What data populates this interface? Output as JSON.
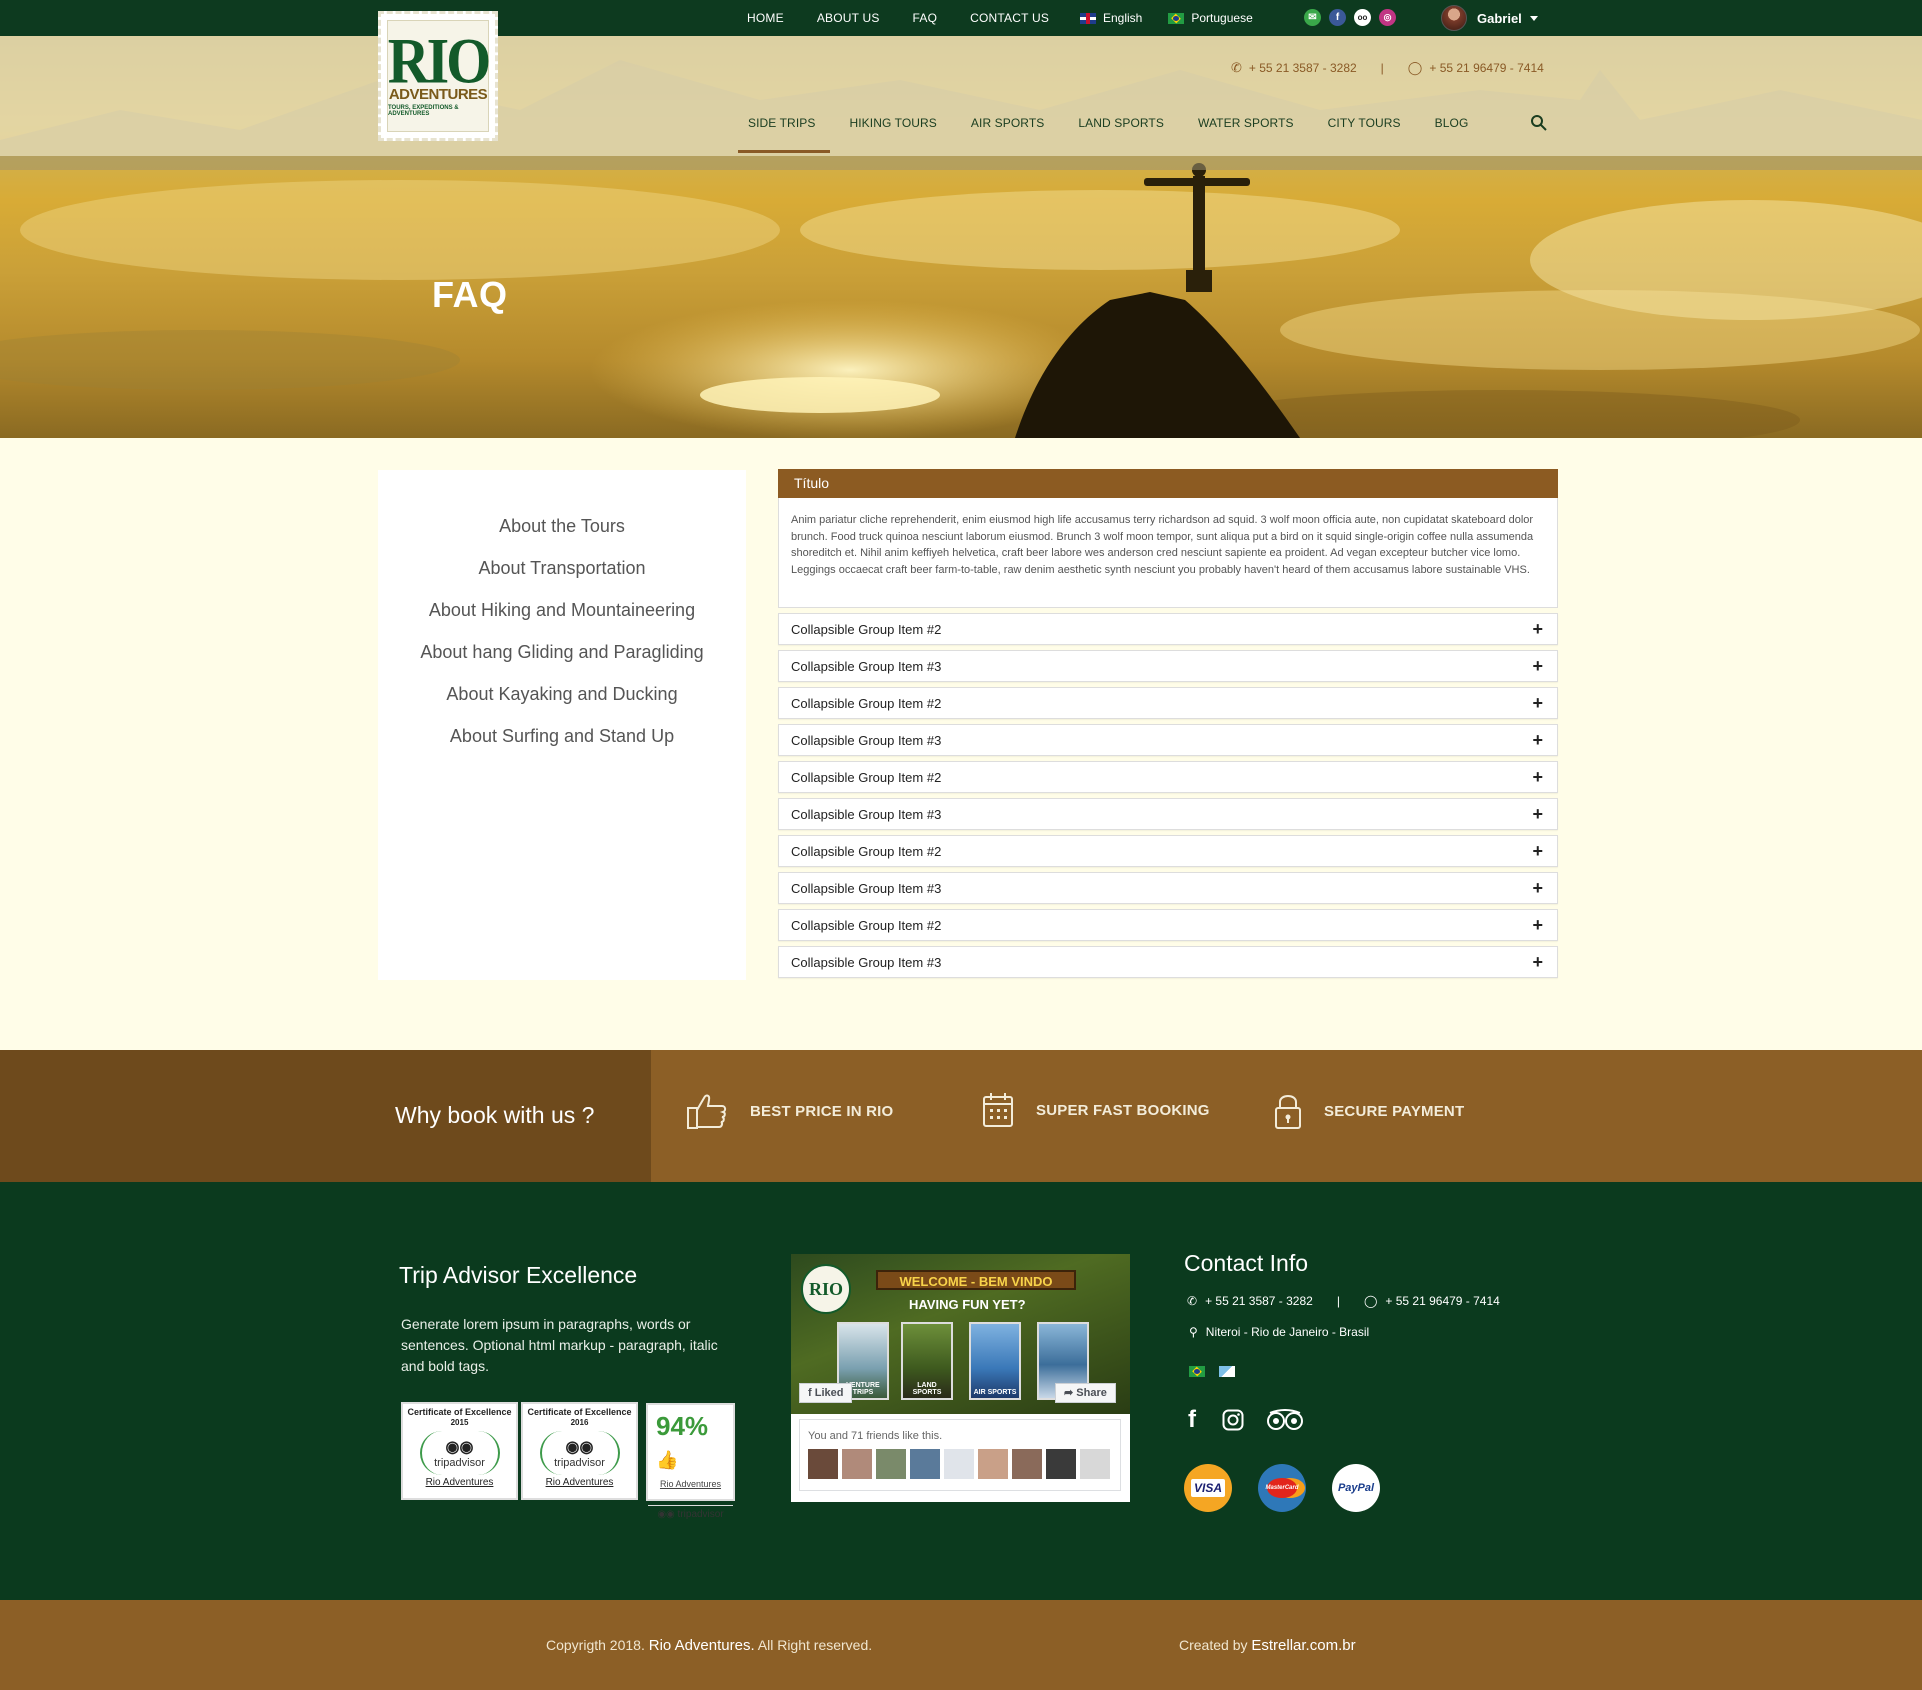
{
  "topbar": {
    "nav": [
      "HOME",
      "ABOUT US",
      "FAQ",
      "CONTACT US"
    ],
    "languages": [
      {
        "label": "English",
        "flag": "uk-flag-icon"
      },
      {
        "label": "Portuguese",
        "flag": "brazil-flag-icon"
      }
    ],
    "socials": [
      {
        "name": "email-icon",
        "color": "#3aa84a"
      },
      {
        "name": "facebook-icon",
        "color": "#3b5998"
      },
      {
        "name": "tripadvisor-icon",
        "color": "#555555"
      },
      {
        "name": "instagram-icon",
        "color": "#c13584"
      }
    ],
    "user": "Gabriel"
  },
  "header": {
    "logo_main": "RIO",
    "logo_sub": "ADVENTURES",
    "logo_tagline": "TOURS, EXPEDITIONS & ADVENTURES",
    "phone": "+ 55 21 3587 - 3282",
    "whatsapp": "+ 55 21 96479 - 7414",
    "separator": "|",
    "nav": [
      "SIDE TRIPS",
      "HIKING TOURS",
      "AIR SPORTS",
      "LAND SPORTS",
      "WATER SPORTS",
      "CITY TOURS",
      "BLOG"
    ],
    "active_nav": "SIDE TRIPS"
  },
  "hero": {
    "title": "FAQ"
  },
  "sidebar": {
    "items": [
      "About the Tours",
      "About Transportation",
      "About Hiking and Mountaineering",
      "About hang Gliding and Paragliding",
      "About Kayaking and Ducking",
      "About Surfing and Stand Up"
    ]
  },
  "faq": {
    "open_title": "Título",
    "open_body": "Anim pariatur cliche reprehenderit, enim eiusmod high life accusamus terry richardson ad squid. 3 wolf moon officia aute, non cupidatat skateboard dolor brunch. Food truck quinoa nesciunt laborum eiusmod. Brunch 3 wolf moon tempor, sunt aliqua put a bird on it squid single-origin coffee nulla assumenda shoreditch et. Nihil anim keffiyeh helvetica, craft beer labore wes anderson cred nesciunt sapiente ea proident. Ad vegan excepteur butcher vice lomo. Leggings occaecat craft beer farm-to-table, raw denim aesthetic synth nesciunt you probably haven't heard of them accusamus labore sustainable VHS.",
    "items": [
      "Collapsible Group Item #2",
      "Collapsible Group Item #3",
      "Collapsible Group Item #2",
      "Collapsible Group Item #3",
      "Collapsible Group Item #2",
      "Collapsible Group Item #3",
      "Collapsible Group Item #2",
      "Collapsible Group Item #3",
      "Collapsible Group Item #2",
      "Collapsible Group Item #3"
    ],
    "plus": "+"
  },
  "why": {
    "title": "Why book with us ?",
    "items": [
      "BEST PRICE IN RIO",
      "SUPER FAST BOOKING",
      "SECURE PAYMENT"
    ]
  },
  "footer": {
    "tripadvisor_title": "Trip Advisor Excellence",
    "tripadvisor_text": "Generate lorem ipsum in paragraphs, words or sentences. Optional html markup - paragraph, italic and bold tags.",
    "certs": [
      {
        "title": "Certificate of Excellence",
        "year": "2015",
        "brand": "tripadvisor",
        "link": "Rio Adventures"
      },
      {
        "title": "Certificate of Excellence",
        "year": "2016",
        "brand": "tripadvisor",
        "link": "Rio Adventures"
      }
    ],
    "score": {
      "value": "94%",
      "link": "Rio Adventures",
      "brand": "tripadvisor"
    },
    "fb": {
      "welcome": "WELCOME - BEM VINDO",
      "fun": "HAVING FUN YET?",
      "liked": "Liked",
      "share": "Share",
      "likes_text": "You and 71 friends like this.",
      "pic_labels": [
        "VENTURE TRIPS",
        "LAND SPORTS",
        "AIR SPORTS",
        ""
      ]
    },
    "contact_title": "Contact Info",
    "phone": "+ 55 21 3587 - 3282",
    "whatsapp": "+ 55 21 96479 - 7414",
    "separator": "|",
    "address": "Niteroi - Rio de Janeiro - Brasil",
    "payments": [
      "VISA",
      "MasterCard",
      "PayPal"
    ]
  },
  "copyright": {
    "left_pre": "Copyrigth 2018.",
    "left_brand": "Rio Adventures.",
    "left_post": "All Right reserved.",
    "right_pre": "Created by",
    "right_brand": "Estrellar.com.br"
  },
  "colors": {
    "dark_green": "#0b3a1e",
    "brown": "#8c5f26",
    "dark_brown": "#6e4a1c",
    "cream": "#fffde8"
  }
}
